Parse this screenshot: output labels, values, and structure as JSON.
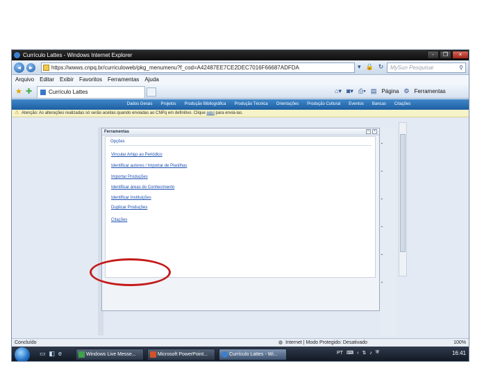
{
  "window": {
    "title": "Currículo Lattes - Windows Internet Explorer",
    "controls": {
      "minimize": "-",
      "restore": "❐",
      "close": "×"
    }
  },
  "addressbar": {
    "back": "◄",
    "forward": "►",
    "url": "https://wwws.cnpq.br/curriculoweb/pkg_menumenu?f_cod=A42487EE7CE2DEC7016F66687ADFDA",
    "search_placeholder": "MySun Pesquisar"
  },
  "menubar": [
    "Arquivo",
    "Editar",
    "Exibir",
    "Favoritos",
    "Ferramentas",
    "Ajuda"
  ],
  "tab": {
    "label": "Currículo Lattes"
  },
  "commandbar": {
    "page": "Página",
    "tools": "Ferramentas"
  },
  "sitenav": [
    "Dados Gerais",
    "Projetos",
    "Produção Bibliográfica",
    "Produção Técnica",
    "Orientações",
    "Produção Cultural",
    "Eventos",
    "Bancas",
    "Citações"
  ],
  "warning": {
    "text_before": "Atenção: As alterações realizadas só serão aceitas quando enviadas ao CNPq em definitivo. Clique",
    "link": "aqui",
    "text_after": "para enviá-las."
  },
  "panel": {
    "title": "Ferramentas",
    "heading": "Opções",
    "options": [
      "Vincular Artigo ao Periódico",
      "Identificar autores / Importar de Planilhas",
      "Importar Produções",
      "Identificar áreas do Conhecimento",
      "Identificar Instituições",
      "Duplicar Produções",
      "Citações"
    ]
  },
  "statusbar": {
    "left": "Concluído",
    "zone": "Internet | Modo Protegido: Desativado",
    "zoom": "100%"
  },
  "taskbar": {
    "buttons": [
      "Windows Live Messe...",
      "Microsoft PowerPoint...",
      "Currículo Lattes - Wi..."
    ],
    "language": "PT",
    "clock": "16:41"
  }
}
